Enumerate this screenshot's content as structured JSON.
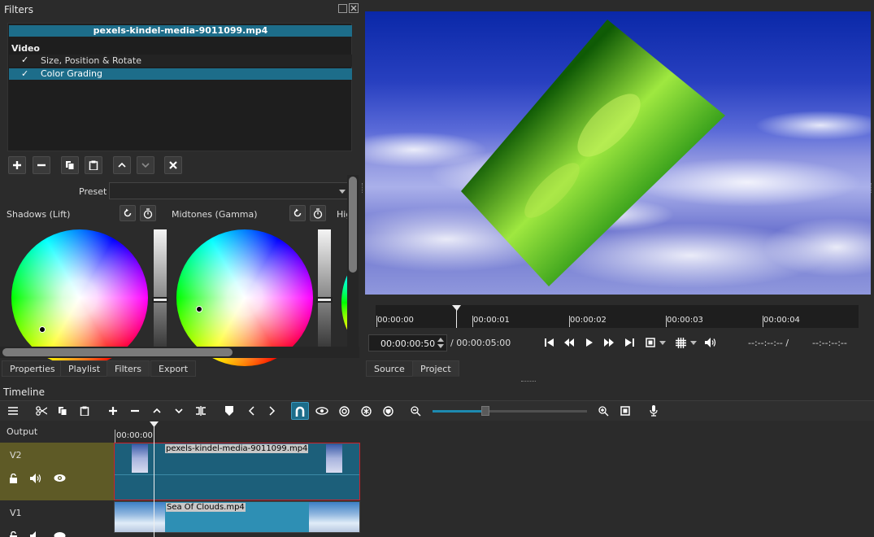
{
  "filters_panel": {
    "title": "Filters",
    "clip_name": "pexels-kindel-media-9011099.mp4",
    "section_label": "Video",
    "filters": [
      {
        "check": "✓",
        "name": "Size, Position & Rotate",
        "selected": false
      },
      {
        "check": "✓",
        "name": "Color Grading",
        "selected": true
      }
    ],
    "preset_label": "Preset",
    "preset_value": "",
    "wheels": [
      {
        "label": "Shadows (Lift)"
      },
      {
        "label": "Midtones (Gamma)"
      },
      {
        "label": "Hig"
      }
    ]
  },
  "left_tabs": [
    "Properties",
    "Playlist",
    "Filters",
    "Export"
  ],
  "left_active_tab": "Filters",
  "player": {
    "ruler_labels": [
      "00:00:00",
      "00:00:01",
      "00:00:02",
      "00:00:03",
      "00:00:04"
    ],
    "current_time": "00:00:00:50",
    "total_time": "/ 00:00:05:00",
    "in_point": "--:--:--:-- /",
    "out_point": "--:--:--:--",
    "tabs": [
      "Source",
      "Project"
    ],
    "active_tab": "Project"
  },
  "timeline": {
    "title": "Timeline",
    "output_label": "Output",
    "ruler_time": "00:00:00",
    "tracks": [
      {
        "name": "V2",
        "clip": "pexels-kindel-media-9011099.mp4"
      },
      {
        "name": "V1",
        "clip": "Sea Of Clouds.mp4"
      }
    ]
  },
  "colors": {
    "accent": "#1d6d8a",
    "clip_selected_border": "#d0202a",
    "track_header_v2": "#5e5a26",
    "panel": "#2b2b2b"
  }
}
